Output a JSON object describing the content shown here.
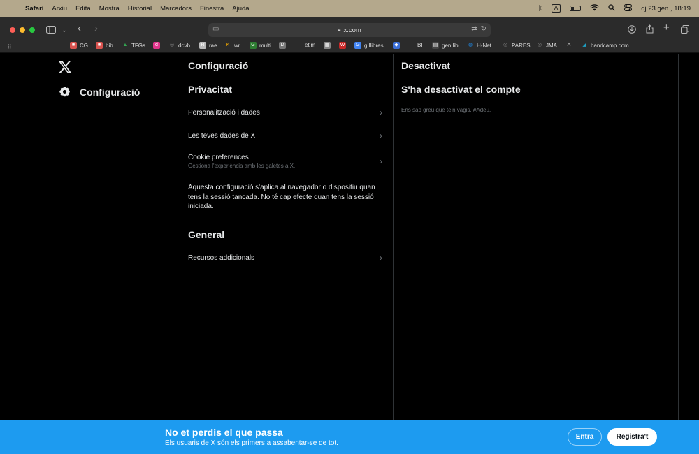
{
  "menubar": {
    "app": "Safari",
    "items": [
      "Arxiu",
      "Edita",
      "Mostra",
      "Historial",
      "Marcadors",
      "Finestra",
      "Ajuda"
    ],
    "input_source": "A",
    "datetime": "dj 23 gen., 18:19"
  },
  "browser": {
    "url": "x.com",
    "favorites": [
      {
        "label": "CG",
        "icon": "red-square-icon",
        "color": "#d9534f"
      },
      {
        "label": "bib",
        "icon": "red-square-icon",
        "color": "#d9534f"
      },
      {
        "label": "TFGs",
        "icon": "drive-icon",
        "color": "#34a853"
      },
      {
        "label": "",
        "icon": "pink-d-icon",
        "color": "#e0338a"
      },
      {
        "label": "dcvb",
        "icon": "globe-icon",
        "color": "#888888"
      },
      {
        "label": "rae",
        "icon": "rae-icon",
        "color": "#bbbbbb"
      },
      {
        "label": "wr",
        "icon": "wr-icon",
        "color": "#f2a900"
      },
      {
        "label": "multi",
        "icon": "multi-icon",
        "color": "#2e7d32"
      },
      {
        "label": "",
        "icon": "df-icon",
        "color": "#777777"
      },
      {
        "label": "etim",
        "icon": "",
        "color": ""
      },
      {
        "label": "",
        "icon": "qr-icon",
        "color": "#888888"
      },
      {
        "label": "",
        "icon": "red-w-icon",
        "color": "#c62828"
      },
      {
        "label": "g.llibres",
        "icon": "google-icon",
        "color": "#4285f4"
      },
      {
        "label": "",
        "icon": "blue-shape-icon",
        "color": "#3b6fd8"
      },
      {
        "label": "BF",
        "icon": "",
        "color": ""
      },
      {
        "label": "gen.lib",
        "icon": "genlib-icon",
        "color": "#444444"
      },
      {
        "label": "H-Net",
        "icon": "drop-icon",
        "color": "#1e88e5"
      },
      {
        "label": "PARES",
        "icon": "globe-icon",
        "color": "#888888"
      },
      {
        "label": "JMA",
        "icon": "globe-icon",
        "color": "#888888"
      },
      {
        "label": "",
        "icon": "a-icon",
        "color": "#dddddd"
      },
      {
        "label": "bandcamp.com",
        "icon": "bandcamp-icon",
        "color": "#1da0c3"
      }
    ]
  },
  "nav": {
    "settings_label": "Configuració"
  },
  "settings": {
    "title": "Configuració",
    "privacy_title": "Privacitat",
    "rows": [
      {
        "label": "Personalització i dades",
        "sub": ""
      },
      {
        "label": "Les teves dades de X",
        "sub": ""
      },
      {
        "label": "Cookie preferences",
        "sub": "Gestiona l'experiència amb les galetes a X."
      }
    ],
    "note": "Aquesta configuració s'aplica al navegador o dispositiu quan tens la sessió tancada. No té cap efecte quan tens la sessió iniciada.",
    "general_title": "General",
    "general_row": "Recursos addicionals"
  },
  "deactivated": {
    "title": "Desactivat",
    "heading": "S'ha desactivat el compte",
    "text": "Ens sap greu que te'n vagis. #Adeu."
  },
  "banner": {
    "title": "No et perdis el que passa",
    "subtitle": "Els usuaris de X són els primers a assabentar-se de tot.",
    "login": "Entra",
    "signup": "Registra't",
    "color": "#1d9bf0"
  }
}
